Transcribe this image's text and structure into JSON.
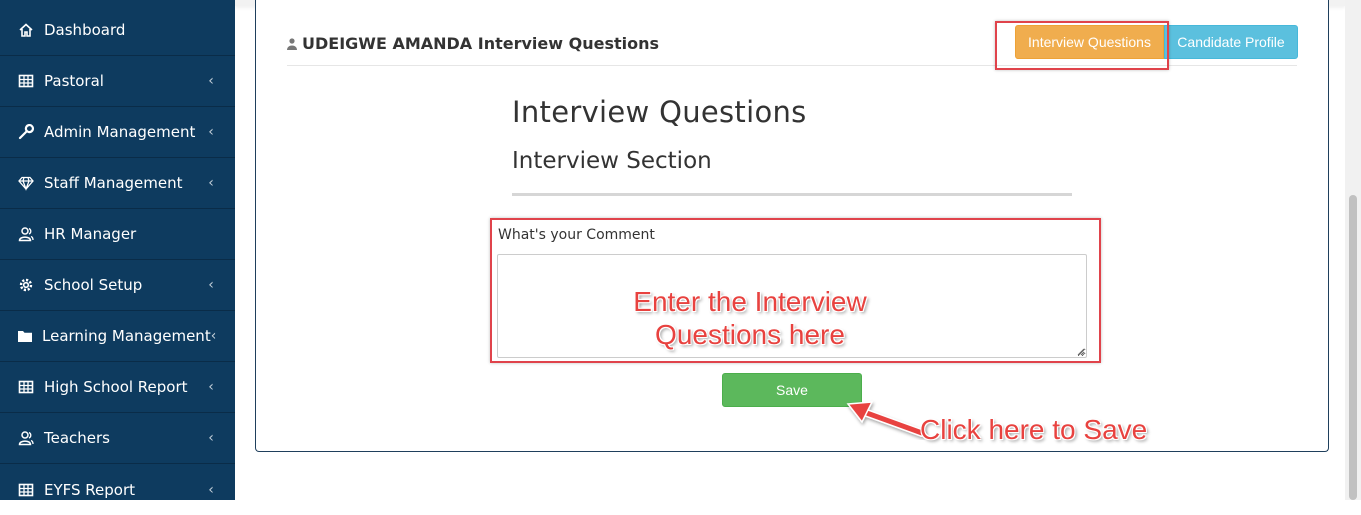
{
  "sidebar": {
    "items": [
      {
        "label": "Dashboard",
        "icon": "home-icon",
        "has_chevron": false
      },
      {
        "label": "Pastoral",
        "icon": "table-icon",
        "has_chevron": true
      },
      {
        "label": "Admin Management",
        "icon": "wrench-icon",
        "has_chevron": true
      },
      {
        "label": "Staff Management",
        "icon": "diamond-icon",
        "has_chevron": true
      },
      {
        "label": "HR Manager",
        "icon": "users-icon",
        "has_chevron": false
      },
      {
        "label": "School Setup",
        "icon": "gear-icon",
        "has_chevron": true
      },
      {
        "label": "Learning Management",
        "icon": "folder-icon",
        "has_chevron": true
      },
      {
        "label": "High School Report",
        "icon": "table-icon",
        "has_chevron": true
      },
      {
        "label": "Teachers",
        "icon": "users-icon",
        "has_chevron": true
      },
      {
        "label": "EYFS Report",
        "icon": "table-icon",
        "has_chevron": true
      }
    ],
    "chevron": "‹",
    "bg_color": "#0e3b5f"
  },
  "card": {
    "title": "UDEIGWE AMANDA Interview Questions",
    "tabs": {
      "interview_questions": "Interview Questions",
      "candidate_profile": "Candidate Profile"
    }
  },
  "section": {
    "heading": "Interview Questions",
    "subheading": "Interview Section"
  },
  "form": {
    "comment_label": "What's your Comment",
    "comment_value": "",
    "save_label": "Save"
  },
  "annotations": {
    "enter_line1": "Enter the Interview",
    "enter_line2": "Questions here",
    "click_save": "Click here to Save"
  },
  "colors": {
    "warning": "#f0ad4e",
    "info": "#5bc0de",
    "success": "#5cb85c",
    "highlight": "#e0434b"
  }
}
